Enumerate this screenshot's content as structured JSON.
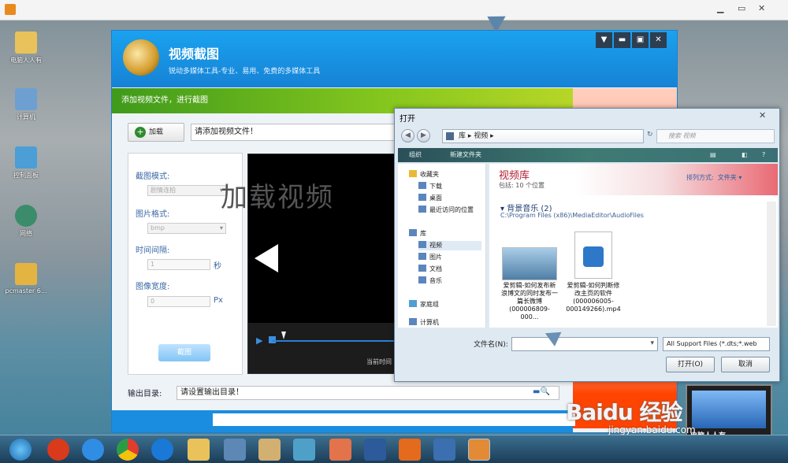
{
  "desktop": {
    "icons": [
      {
        "label": "电脑人人有"
      },
      {
        "label": "计算机"
      },
      {
        "label": "控制面板"
      },
      {
        "label": "网络"
      },
      {
        "label": "pcmaster 6..."
      }
    ]
  },
  "app": {
    "title": "视频截图",
    "subtitle": "锐动多媒体工具-专业、易用、免费的多媒体工具",
    "banner": "添加视频文件，进行截图",
    "load_button": "加载",
    "video_placeholder": "请添加视频文件！",
    "settings": {
      "mode_label": "截图模式:",
      "mode_value": "剧情连拍",
      "format_label": "图片格式:",
      "format_value": "bmp",
      "interval_label": "时间间隔:",
      "interval_value": "1",
      "interval_unit": "秒",
      "width_label": "图像宽度:",
      "width_value": "0",
      "width_unit": "Px",
      "capture_button": "截图"
    },
    "player": {
      "time_label": "当前时间"
    },
    "output_label": "输出目录:",
    "output_placeholder": "请设置输出目录！"
  },
  "dialog": {
    "title": "打开",
    "address": [
      "库",
      "视频"
    ],
    "search_placeholder": "搜索 视频",
    "toolbar": {
      "organize": "组织",
      "new_folder": "新建文件夹"
    },
    "nav": {
      "favorites": "收藏夹",
      "downloads": "下载",
      "desktop": "桌面",
      "recent": "最近访问的位置",
      "libraries": "库",
      "videos": "视频",
      "pictures": "图片",
      "documents": "文档",
      "music": "音乐",
      "homegroup": "家庭组",
      "computer": "计算机"
    },
    "library": {
      "title": "视频库",
      "contains": "包括: 10 个位置",
      "sort_label": "排列方式:",
      "sort_value": "文件夹"
    },
    "group": {
      "name": "背景音乐 (2)",
      "path": "C:\\Program Files (x86)\\MediaEditor\\AudioFiles"
    },
    "files": [
      {
        "name": "爱剪辑-如何发布新浪博文的同时发布一篇长微博(000006809-000..."
      },
      {
        "name": "爱剪辑-如何判断修改主页的软件(000006005-000149266).mp4"
      }
    ],
    "filename_label": "文件名(N):",
    "filetype": "All Support Files (*.dts;*.web",
    "open_button": "打开(O)",
    "cancel_button": "取消"
  },
  "watermark": "加载视频",
  "baidu": {
    "logo": "Baidu 经验",
    "url": "jingyan.baidu.com",
    "subtitle": "电脑人人有"
  },
  "icons": {
    "start": "windows-orb-icon",
    "browser": "ie-icon",
    "chrome": "chrome-icon"
  }
}
